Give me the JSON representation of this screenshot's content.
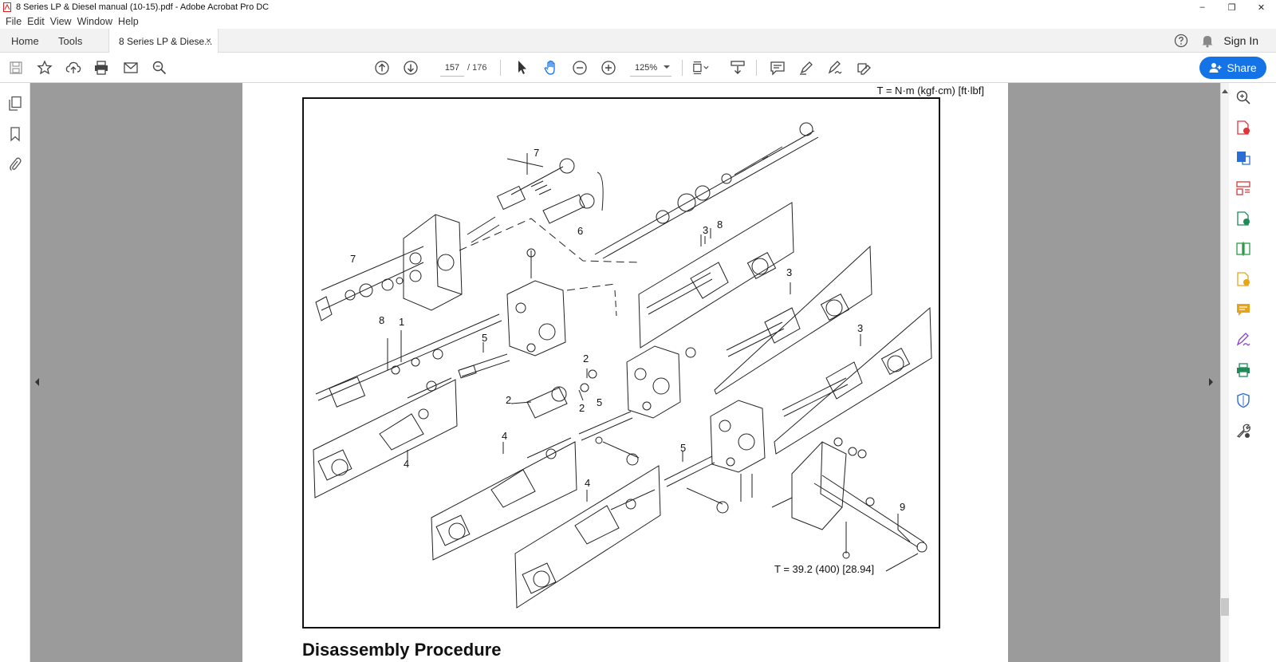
{
  "window": {
    "title": "8 Series LP & Diesel manual (10-15).pdf - Adobe Acrobat Pro DC",
    "controls": {
      "minimize": "–",
      "restore": "❐",
      "close": "✕"
    }
  },
  "menu": [
    "File",
    "Edit",
    "View",
    "Window",
    "Help"
  ],
  "tabs": {
    "home": "Home",
    "tools": "Tools",
    "document": "8 Series LP & Diese...",
    "close_glyph": "×",
    "sign_in": "Sign In"
  },
  "toolbar": {
    "page_current": "157",
    "page_total": "/  176",
    "zoom": "125%",
    "share_label": "Share"
  },
  "document": {
    "torque_units": "T = N·m (kgf·cm) [ft·lbf]",
    "torque_value": "T = 39.2 (400) [28.94]",
    "callouts": {
      "c7a": "7",
      "c7b": "7",
      "c6": "6",
      "c8a": "8",
      "c8b": "8",
      "c1": "1",
      "c5a": "5",
      "c5b": "5",
      "c5c": "5",
      "c2a": "2",
      "c2b": "2",
      "c2c": "2",
      "c3a": "3",
      "c3b": "3",
      "c3c": "3",
      "c4a": "4",
      "c4b": "4",
      "c4c": "4",
      "c9": "9"
    },
    "next_heading": "Disassembly Procedure"
  },
  "colors": {
    "accent": "#1473e6",
    "doc_background": "#9b9b9b",
    "right_rail_icons": [
      "#e0343a",
      "#2b6dd6",
      "#d23a3a",
      "#1e8a57",
      "#2f9b48",
      "#e8a317",
      "#e8a317",
      "#8b3fd1",
      "#1e8a57",
      "#2b6dd6",
      "#444444"
    ]
  }
}
